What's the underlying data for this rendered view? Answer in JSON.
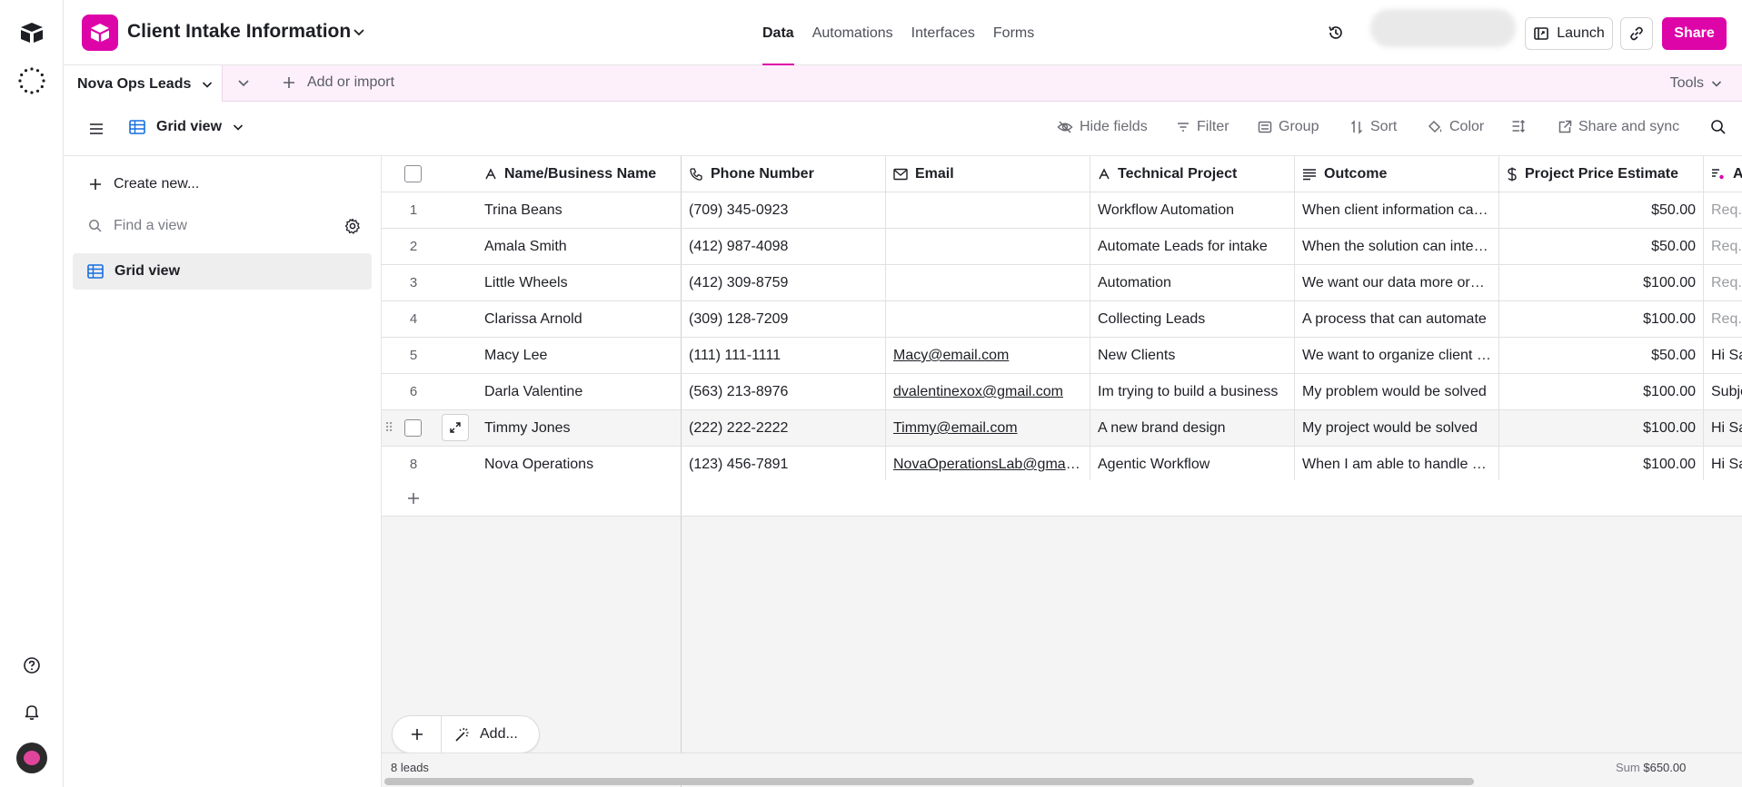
{
  "app": {
    "brand_color": "#dd04a8",
    "base_title": "Client Intake Information"
  },
  "top_tabs": [
    "Data",
    "Automations",
    "Interfaces",
    "Forms"
  ],
  "top_actions": {
    "launch": "Launch",
    "share": "Share"
  },
  "table_bar": {
    "table_name": "Nova Ops Leads",
    "add_import": "Add or import",
    "tools": "Tools"
  },
  "view_bar": {
    "view_name": "Grid view",
    "hide_fields": "Hide fields",
    "filter": "Filter",
    "group": "Group",
    "sort": "Sort",
    "color": "Color",
    "share_sync": "Share and sync"
  },
  "sidebar": {
    "create_new": "Create new...",
    "find_placeholder": "Find a view",
    "views": [
      "Grid view"
    ]
  },
  "grid": {
    "columns": [
      "Name/Business Name",
      "Phone Number",
      "Email",
      "Technical Project",
      "Outcome",
      "Project Price Estimate",
      "A"
    ],
    "rows": [
      {
        "n": "1",
        "name": "Trina Beans",
        "phone": "(709) 345-0923",
        "email": "",
        "project": "Workflow Automation",
        "outcome": "When client information can be collected",
        "price": "$50.00",
        "extra": "Req..."
      },
      {
        "n": "2",
        "name": "Amala Smith",
        "phone": "(412) 987-4098",
        "email": "",
        "project": "Automate Leads for intake",
        "outcome": "When the solution can integrate",
        "price": "$50.00",
        "extra": "Req..."
      },
      {
        "n": "3",
        "name": "Little Wheels",
        "phone": "(412) 309-8759",
        "email": "",
        "project": "Automation",
        "outcome": "We want our data more organized",
        "price": "$100.00",
        "extra": "Req..."
      },
      {
        "n": "4",
        "name": "Clarissa Arnold",
        "phone": "(309) 128-7209",
        "email": "",
        "project": "Collecting Leads",
        "outcome": "A process that can automate",
        "price": "$100.00",
        "extra": "Req..."
      },
      {
        "n": "5",
        "name": "Macy Lee",
        "phone": "(111) 111-1111",
        "email": "Macy@email.com",
        "project": "New Clients",
        "outcome": "We want to organize client data",
        "price": "$50.00",
        "extra": "Hi Sa"
      },
      {
        "n": "6",
        "name": "Darla Valentine",
        "phone": "(563) 213-8976",
        "email": "dvalentinexox@gmail.com",
        "project": "Im trying to build a business",
        "outcome": "My problem would be solved",
        "price": "$100.00",
        "extra": "Subje"
      },
      {
        "n": "7",
        "name": "Timmy Jones",
        "phone": "(222) 222-2222",
        "email": "Timmy@email.com",
        "project": "A new brand design",
        "outcome": "My project would be solved",
        "price": "$100.00",
        "extra": "Hi Sa"
      },
      {
        "n": "8",
        "name": "Nova Operations",
        "phone": "(123) 456-7891",
        "email": "NovaOperationsLab@gmail.com",
        "project": "Agentic Workflow",
        "outcome": "When I am able to handle clients",
        "price": "$100.00",
        "extra": "Hi Sa"
      }
    ],
    "add_label": "Add...",
    "footer_count": "8 leads",
    "footer_sum_label": "Sum",
    "footer_sum_value": "$650.00"
  }
}
